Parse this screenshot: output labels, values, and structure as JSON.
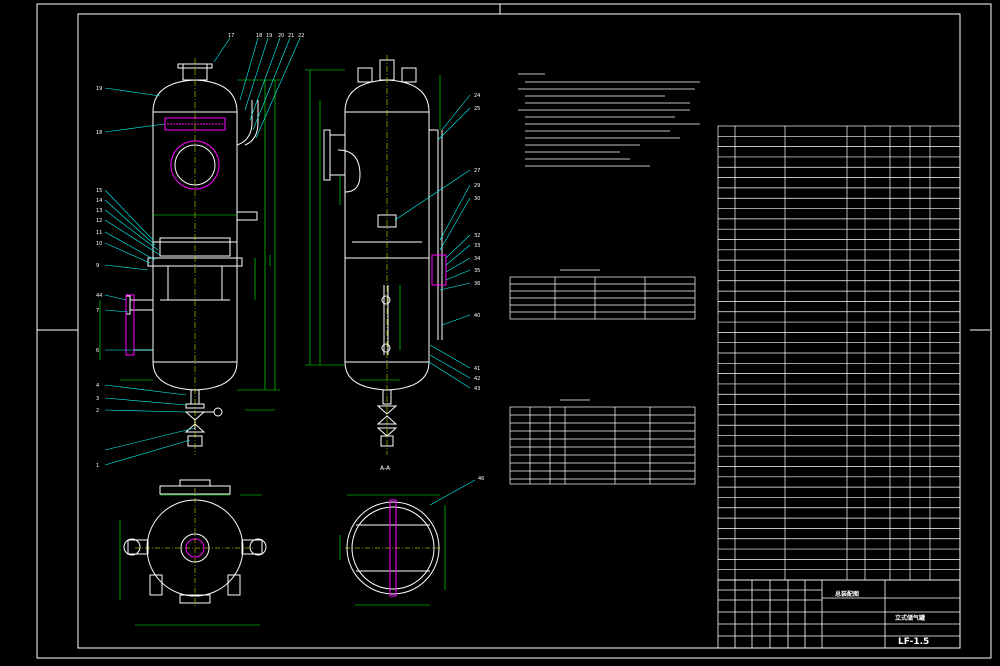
{
  "labels": {
    "section_aa": "A-A",
    "title_block_name": "立式储气罐",
    "title_block_drawing": "总装配图",
    "drawing_number": "LF-1.5"
  },
  "part_numbers_left": [
    "19",
    "18",
    "17",
    "16",
    "15",
    "14",
    "13",
    "12",
    "11",
    "10",
    "9",
    "8",
    "44",
    "7",
    "6",
    "5",
    "4",
    "3",
    "2",
    "1"
  ],
  "part_numbers_top": [
    "17",
    "18",
    "19",
    "20",
    "21",
    "22",
    "23"
  ],
  "part_numbers_right": [
    "24",
    "25",
    "26",
    "27",
    "28",
    "29",
    "30",
    "31",
    "32",
    "33",
    "34",
    "35",
    "36",
    "37",
    "38",
    "39",
    "40",
    "41",
    "42",
    "43",
    "44",
    "45",
    "46"
  ],
  "colors": {
    "background": "#000000",
    "frame": "#ffffff",
    "geometry": "#ffffff",
    "dimensions": "#00ff00",
    "centerlines": "#ffff00",
    "leaders": "#00ffff",
    "detail": "#ff00ff"
  }
}
